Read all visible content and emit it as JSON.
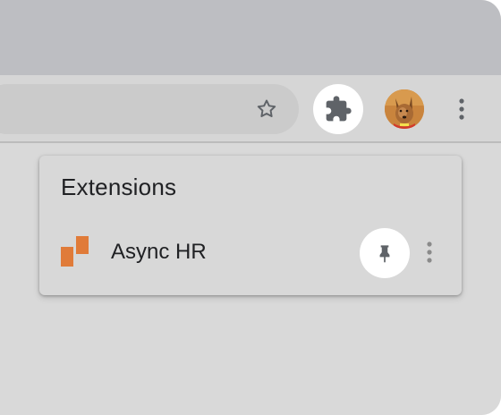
{
  "toolbar": {
    "bookmark_icon": "star-outline-icon",
    "extensions_icon": "puzzle-piece-icon",
    "profile_icon": "profile-avatar",
    "menu_icon": "more-vert-icon"
  },
  "extensions_popup": {
    "title": "Extensions",
    "items": [
      {
        "name": "Async HR",
        "icon": "async-hr-logo",
        "pin_icon": "pin-icon",
        "menu_icon": "more-vert-icon"
      }
    ]
  },
  "colors": {
    "tab_strip": "#bdbec2",
    "toolbar": "#d6d6d6",
    "popup_bg": "#d8d8d8",
    "button_highlight": "#ffffff",
    "icon_gray": "#5f6368",
    "async_hr_orange": "#e07b39"
  }
}
